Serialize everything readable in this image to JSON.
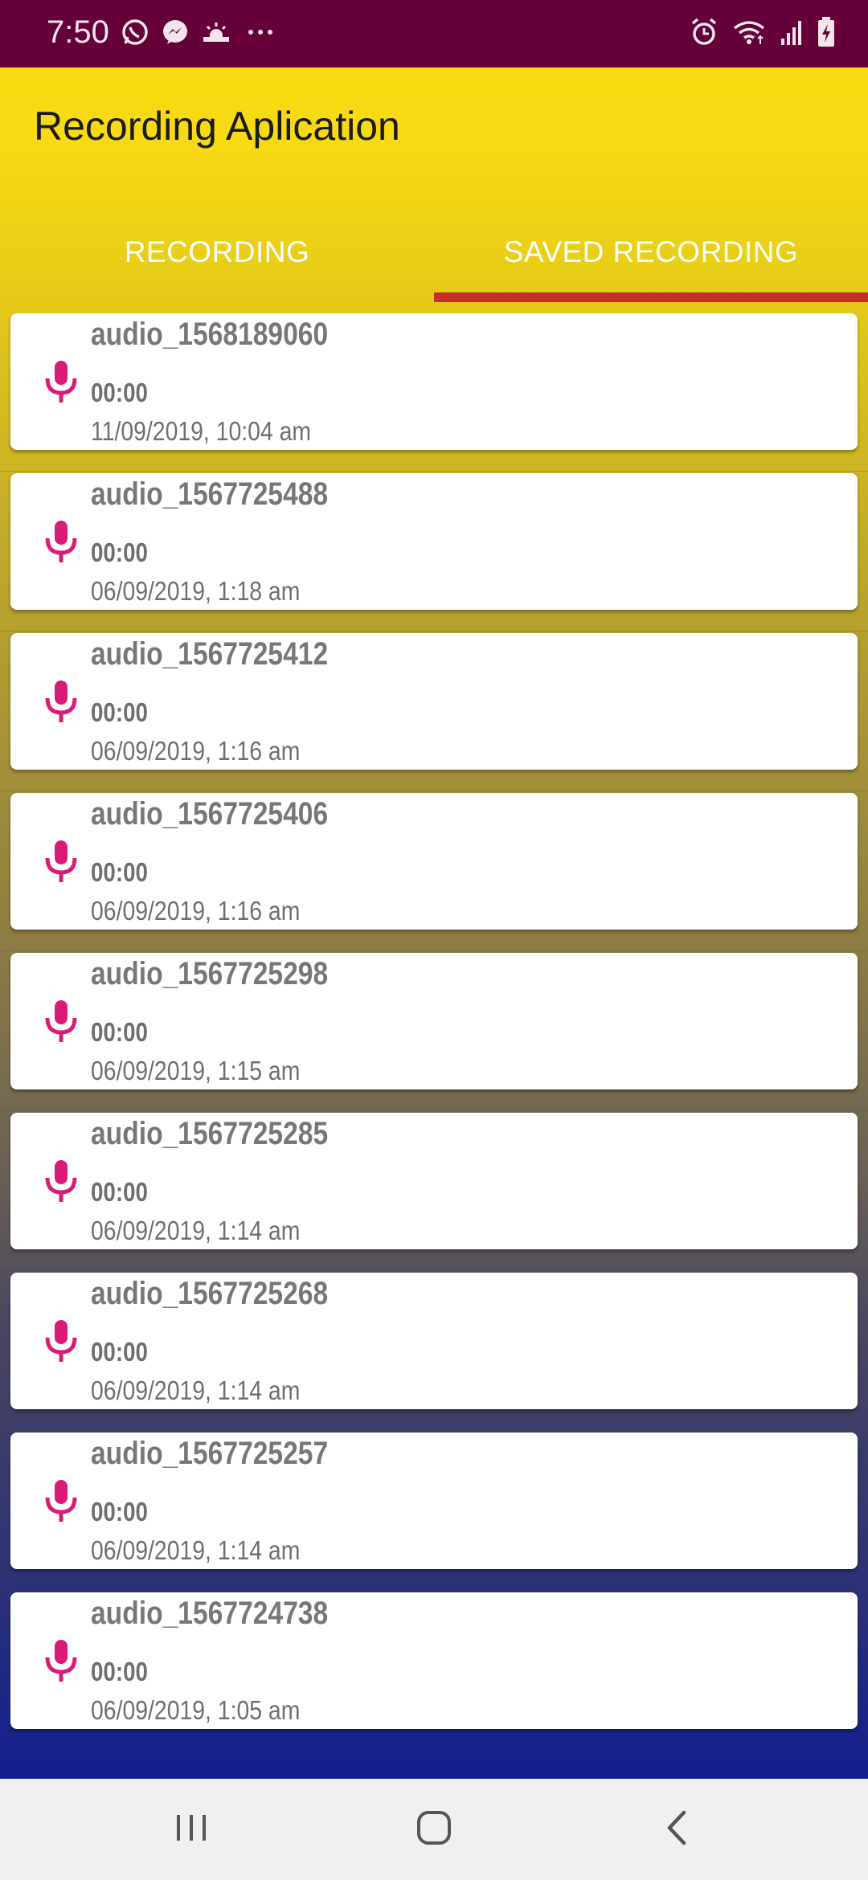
{
  "status_bar": {
    "time": "7:50",
    "left_icons": [
      "whatsapp-icon",
      "messenger-icon",
      "weather-icon",
      "more-dots-icon"
    ],
    "right_icons": [
      "alarm-icon",
      "wifi-icon",
      "signal-icon",
      "battery-charging-icon"
    ]
  },
  "app": {
    "title": "Recording Aplication"
  },
  "tabs": [
    {
      "label": "RECORDING",
      "selected": false
    },
    {
      "label": "SAVED RECORDING",
      "selected": true
    }
  ],
  "recordings": [
    {
      "name": "audio_1568189060",
      "duration": "00:00",
      "date": "11/09/2019, 10:04 am"
    },
    {
      "name": "audio_1567725488",
      "duration": "00:00",
      "date": "06/09/2019, 1:18 am"
    },
    {
      "name": "audio_1567725412",
      "duration": "00:00",
      "date": "06/09/2019, 1:16 am"
    },
    {
      "name": "audio_1567725406",
      "duration": "00:00",
      "date": "06/09/2019, 1:16 am"
    },
    {
      "name": "audio_1567725298",
      "duration": "00:00",
      "date": "06/09/2019, 1:15 am"
    },
    {
      "name": "audio_1567725285",
      "duration": "00:00",
      "date": "06/09/2019, 1:14 am"
    },
    {
      "name": "audio_1567725268",
      "duration": "00:00",
      "date": "06/09/2019, 1:14 am"
    },
    {
      "name": "audio_1567725257",
      "duration": "00:00",
      "date": "06/09/2019, 1:14 am"
    },
    {
      "name": "audio_1567724738",
      "duration": "00:00",
      "date": "06/09/2019, 1:05 am"
    }
  ],
  "colors": {
    "status_bar": "#650038",
    "accent_mic": "#d81b78",
    "tab_indicator": "#c62d2d",
    "header_yellow": "#fbdc10",
    "bottom_blue": "#15208e"
  },
  "nav_bar": {
    "buttons": [
      "recents-icon",
      "home-icon",
      "back-icon"
    ]
  }
}
